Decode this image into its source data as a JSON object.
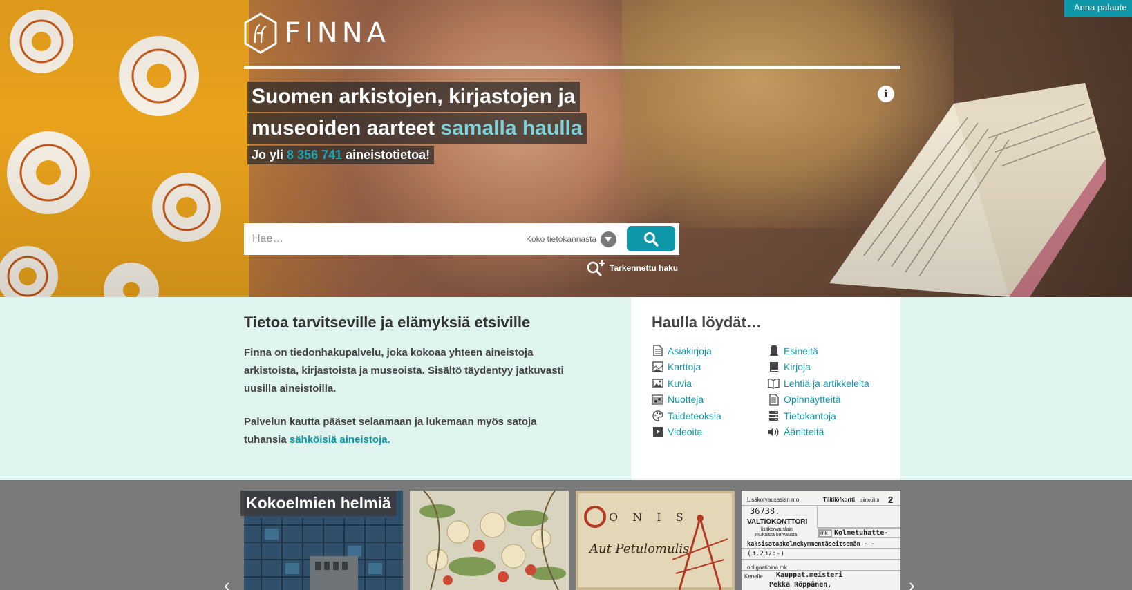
{
  "brand": {
    "name": "FINNA"
  },
  "feedback": {
    "label": "Anna palaute"
  },
  "hero": {
    "headline_1": "Suomen arkistojen, kirjastojen ja",
    "headline_2_a": "museoiden aarteet",
    "headline_2_b": "samalla haulla",
    "count_prefix": "Jo yli",
    "count": "8 356 741",
    "count_suffix": "aineistotietoa!",
    "info_icon_label": "i"
  },
  "search": {
    "placeholder": "Hae…",
    "scope": "Koko tietokannasta",
    "advanced_label": "Tarkennettu haku"
  },
  "intro": {
    "title": "Tietoa tarvitseville ja elämyksiä etsiville",
    "p1": "Finna on tiedonhakupalvelu, joka kokoaa yhteen aineistoja arkistoista, kirjastoista ja museoista. Sisältö täydentyy jatkuvasti uusilla aineistoilla.",
    "p2_text": "Palvelun kautta pääset selaamaan ja lukemaan myös satoja tuhansia ",
    "p2_link": "sähköisiä aineistoja",
    "p2_end": "."
  },
  "finds": {
    "title": "Haulla löydät…",
    "items": [
      {
        "label": "Asiakirjoja",
        "icon": "document-icon"
      },
      {
        "label": "Esineitä",
        "icon": "object-icon"
      },
      {
        "label": "Karttoja",
        "icon": "map-icon"
      },
      {
        "label": "Kirjoja",
        "icon": "book-icon"
      },
      {
        "label": "Kuvia",
        "icon": "image-icon"
      },
      {
        "label": "Lehtiä ja artikkeleita",
        "icon": "journal-icon"
      },
      {
        "label": "Nuotteja",
        "icon": "sheet-music-icon"
      },
      {
        "label": "Opinnäytteitä",
        "icon": "thesis-icon"
      },
      {
        "label": "Taideteoksia",
        "icon": "palette-icon"
      },
      {
        "label": "Tietokantoja",
        "icon": "database-icon"
      },
      {
        "label": "Videoita",
        "icon": "video-icon"
      },
      {
        "label": "Äänitteitä",
        "icon": "sound-icon"
      }
    ]
  },
  "carousel": {
    "title": "Kokoelmien helmiä",
    "prev": "‹",
    "next": "›",
    "tile_3_text": "Aut Petulomulis",
    "tile_3_caps": "O N I S",
    "card": {
      "header_left": "Lisäkorvausasian n:o",
      "header_mid": "Tilitilöfkortti",
      "header_sub": "siirtotilitä",
      "header_num": "2",
      "case_no": "36738.",
      "office": "VALTIOKONTTORI",
      "desc_1": "lisäkorvauslain",
      "desc_2": "mukaista korvausta",
      "mk": "mk",
      "amount_words": "Kolmetuhatte-",
      "amount_line": "kaksisataakolmekymmentäseitsemän - -",
      "amount_num": "(3.237:-)",
      "obligations": "obligaatioina mk",
      "recipient_label": "Kenelle",
      "recipient_1": "Kauppat.meisteri",
      "recipient_2": "Pekka Röppänen,"
    }
  },
  "colors": {
    "accent": "#0e97a9",
    "band": "#dff4ef",
    "carousel_bg": "#7a7a7a"
  }
}
